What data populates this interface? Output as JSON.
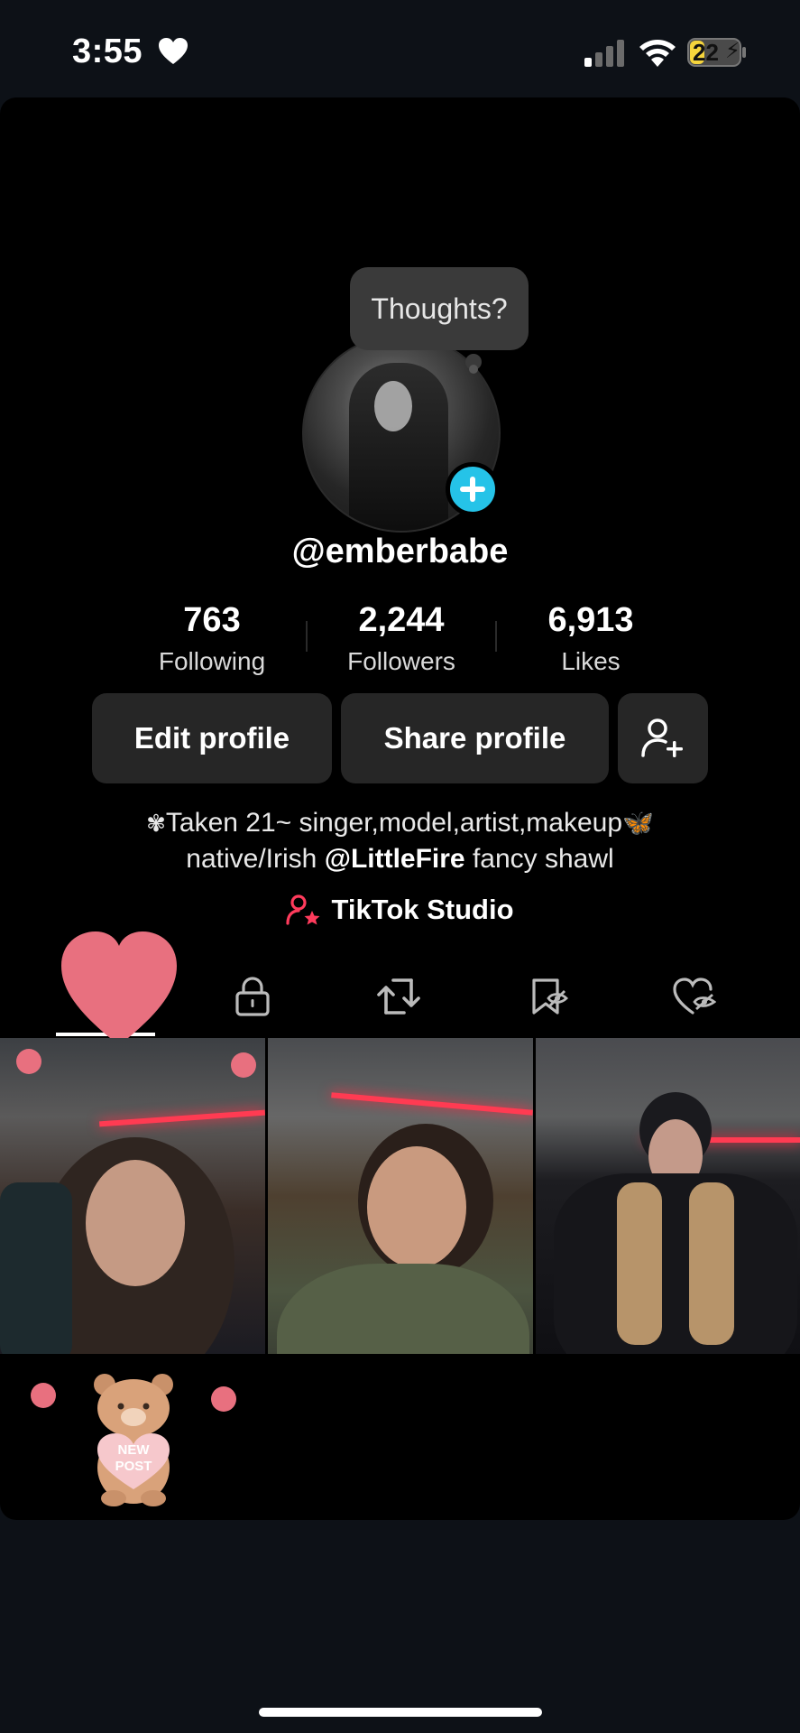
{
  "status_bar": {
    "time": "3:55",
    "battery": "22"
  },
  "profile": {
    "bubble": "Thoughts?",
    "username": "@emberbabe",
    "stats": [
      {
        "value": "763",
        "label": "Following"
      },
      {
        "value": "2,244",
        "label": "Followers"
      },
      {
        "value": "6,913",
        "label": "Likes"
      }
    ],
    "buttons": {
      "edit": "Edit profile",
      "share": "Share profile"
    },
    "bio": {
      "line1": "Taken 21~ singer,model,artist,makeup",
      "line2_prefix": "native/Irish ",
      "mention": "@LittleFire",
      "line2_suffix": " fancy shawl"
    },
    "studio": "TikTok Studio"
  },
  "tabs": [
    "videos-grid",
    "private-lock",
    "reposts",
    "favorites",
    "liked"
  ],
  "sticker": {
    "text1": "NEW",
    "text2": "POST"
  },
  "colors": {
    "accent_blue": "#25c3e8",
    "sticker_pink": "#e8707f",
    "battery_yellow": "#f6d53c"
  }
}
